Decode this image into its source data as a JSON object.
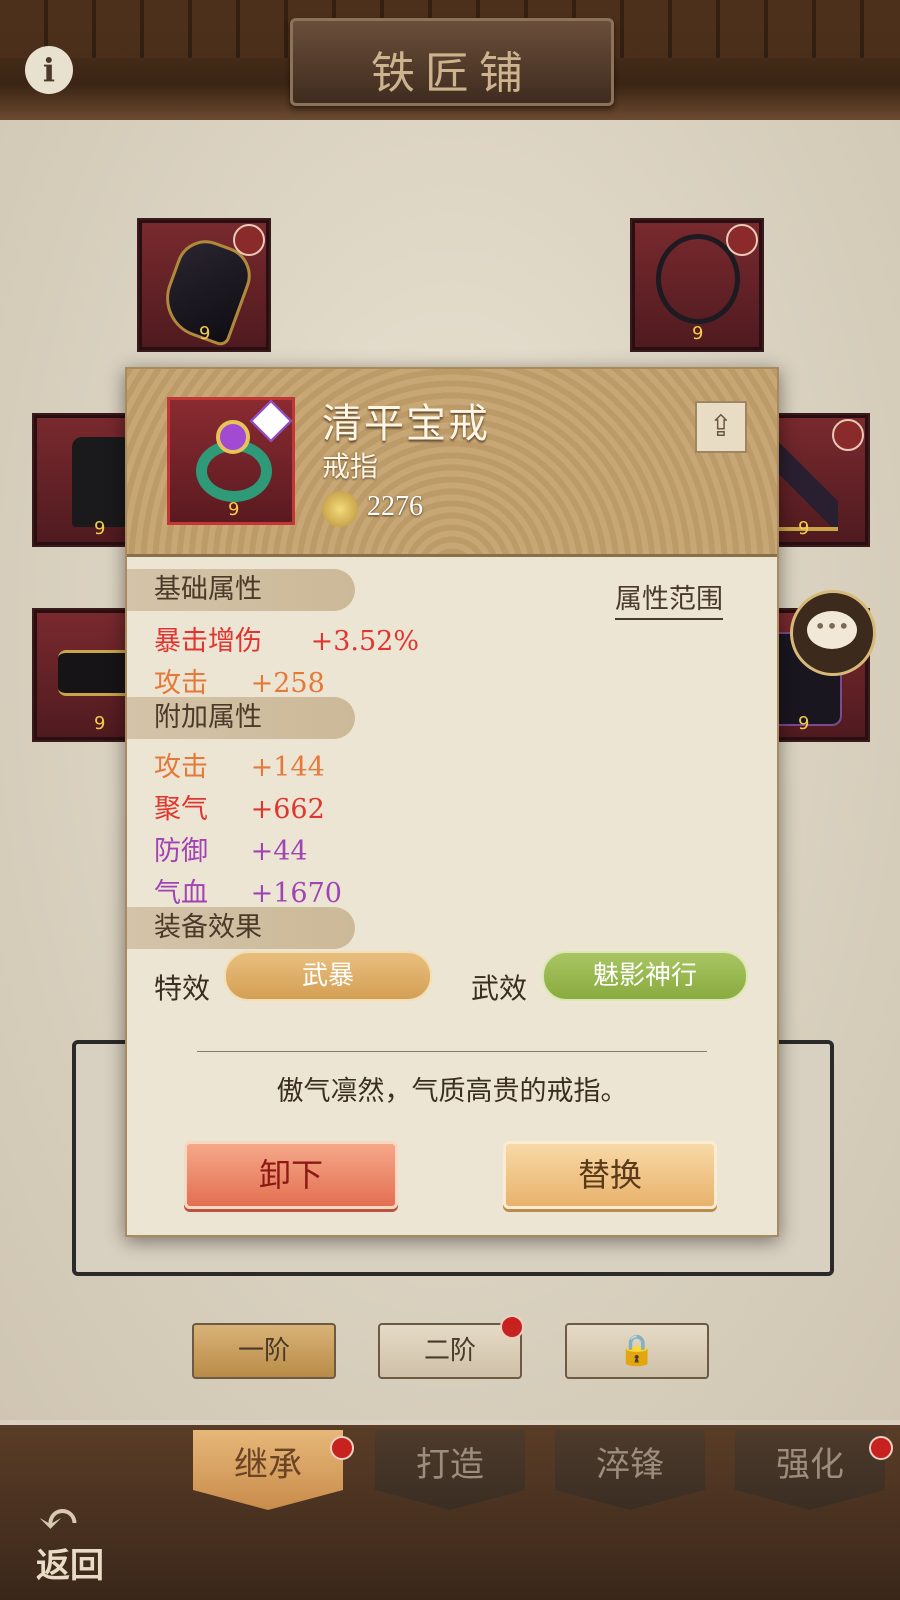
{
  "header": {
    "title": "铁匠铺",
    "info_icon": "i"
  },
  "slots": [
    {
      "name": "bracer",
      "number": "9"
    },
    {
      "name": "necklace",
      "number": "9"
    },
    {
      "name": "robe",
      "number": "9"
    },
    {
      "name": "weapon",
      "number": "9"
    },
    {
      "name": "belt",
      "number": "9"
    },
    {
      "name": "boots",
      "number": "9"
    }
  ],
  "tiers": {
    "tier1": "一阶",
    "tier2": "二阶"
  },
  "tabs": {
    "inherit": "继承",
    "forge": "打造",
    "temper": "淬锋",
    "enhance": "强化"
  },
  "back_label": "返回",
  "popup": {
    "item_name": "清平宝戒",
    "item_type": "戒指",
    "item_number": "9",
    "power": "2276",
    "basic_header": "基础属性",
    "range_link": "属性范围",
    "basic_stats": [
      {
        "name": "暴击增伤",
        "value": "+3.52%",
        "color": "#e1352f"
      },
      {
        "name": "攻击",
        "value": "+258",
        "color": "#e4793a"
      }
    ],
    "extra_header": "附加属性",
    "extra_stats": [
      {
        "name": "攻击",
        "value": "+144",
        "color": "#e4793a"
      },
      {
        "name": "聚气",
        "value": "+662",
        "color": "#e1352f"
      },
      {
        "name": "防御",
        "value": "+44",
        "color": "#a044b4"
      },
      {
        "name": "气血",
        "value": "+1670",
        "color": "#a044b4"
      }
    ],
    "effect_header": "装备效果",
    "special_label": "特效",
    "special_value": "武暴",
    "wu_label": "武效",
    "wu_value": "魅影神行",
    "description": "傲气凛然，气质高贵的戒指。",
    "unequip_label": "卸下",
    "replace_label": "替换"
  },
  "icons": [
    "info-icon",
    "share-icon",
    "chat-icon",
    "lock-icon",
    "back-arrow-icon",
    "power-icon"
  ]
}
